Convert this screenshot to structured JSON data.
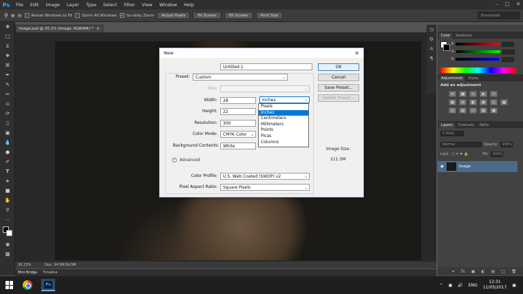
{
  "app": {
    "logo": "Ps"
  },
  "menu": [
    "File",
    "Edit",
    "Image",
    "Layer",
    "Type",
    "Select",
    "Filter",
    "View",
    "Window",
    "Help"
  ],
  "options_bar": {
    "resize_windows": "Resize Windows to Fit",
    "zoom_all": "Zoom All Windows",
    "scrubby_zoom": "Scrubby Zoom",
    "actual_pixels": "Actual Pixels",
    "fit_screen": "Fit Screen",
    "fill_screen": "Fill Screen",
    "print_size": "Print Size",
    "workspace": "Essentials"
  },
  "document": {
    "tab_title": "Image.psd @ 20.1% (Image, RGB/8#) *",
    "zoom": "20.13%",
    "doc_info": "Doc: 34.5M/34.5M"
  },
  "bottom_tabs": [
    "Mini Bridge",
    "Timeline"
  ],
  "panels": {
    "color_tabs": [
      "Color",
      "Swatches"
    ],
    "color_channels": [
      "R",
      "G",
      "B"
    ],
    "adjust_tabs": [
      "Adjustments",
      "Styles"
    ],
    "adjust_hint": "Add an adjustment",
    "layers_tabs": [
      "Layers",
      "Channels",
      "Paths"
    ],
    "kind_label": "Kind",
    "blend_mode": "Normal",
    "opacity_label": "Opacity:",
    "opacity_value": "100%",
    "lock_label": "Lock:",
    "fill_label": "Fill:",
    "fill_value": "100%",
    "layer_name": "Image"
  },
  "dialog": {
    "title": "New",
    "name_label": "Name:",
    "name_value": "Untitled-1",
    "preset_label": "Preset:",
    "preset_value": "Custom",
    "size_label": "Size:",
    "width_label": "Width:",
    "width_value": "28",
    "width_unit": "Inches",
    "height_label": "Height:",
    "height_value": "22",
    "resolution_label": "Resolution:",
    "resolution_value": "300",
    "color_mode_label": "Color Mode:",
    "color_mode_value": "CMYK Color",
    "bg_label": "Background Contents:",
    "bg_value": "White",
    "advanced_label": "Advanced",
    "profile_label": "Color Profile:",
    "profile_value": "U.S. Web Coated (SWOP) v2",
    "aspect_label": "Pixel Aspect Ratio:",
    "aspect_value": "Square Pixels",
    "image_size_label": "Image Size:",
    "image_size_value": "211.5M",
    "ok": "OK",
    "cancel": "Cancel",
    "save_preset": "Save Preset...",
    "delete_preset": "Delete Preset...",
    "unit_options": [
      "Pixels",
      "Inches",
      "Centimeters",
      "Millimeters",
      "Points",
      "Picas",
      "Columns"
    ],
    "selected_unit": "Inches"
  },
  "taskbar": {
    "lang": "ENG",
    "time": "12:31",
    "date": "11/05/2017"
  }
}
